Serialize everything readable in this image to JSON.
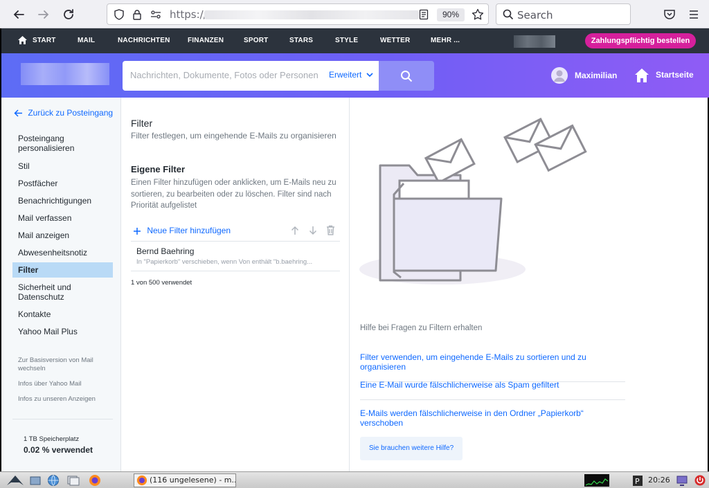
{
  "browser": {
    "url": "https://",
    "zoom": "90%",
    "search_placeholder": "Search"
  },
  "portal_nav": {
    "items": [
      "START",
      "MAIL",
      "NACHRICHTEN",
      "FINANZEN",
      "SPORT",
      "STARS",
      "STYLE",
      "WETTER",
      "MEHR ..."
    ],
    "subscribe": "Zahlungspflichtig bestellen"
  },
  "header": {
    "search_placeholder": "Nachrichten, Dokumente, Fotos oder Personen",
    "advanced": "Erweitert",
    "user_name": "Maximilian",
    "home": "Startseite"
  },
  "sidebar": {
    "back": "Zurück zu Posteingang",
    "items": [
      "Posteingang personalisieren",
      "Stil",
      "Postfächer",
      "Benachrichtigungen",
      "Mail verfassen",
      "Mail anzeigen",
      "Abwesenheitsnotiz",
      "Filter",
      "Sicherheit und Datenschutz",
      "Kontakte",
      "Yahoo Mail Plus"
    ],
    "links": [
      "Zur Basisversion von Mail wechseln",
      "Infos über Yahoo Mail",
      "Infos zu unseren Anzeigen"
    ],
    "storage_label": "1 TB Speicherplatz",
    "storage_value": "0.02 % verwendet"
  },
  "filters": {
    "title": "Filter",
    "subtitle": "Filter festlegen, um eingehende E-Mails zu organisieren",
    "own_title": "Eigene Filter",
    "own_desc": "Einen Filter hinzufügen oder anklicken, um E-Mails neu zu sortieren, zu bearbeiten oder zu löschen. Filter sind nach Priorität aufgelistet",
    "add": "Neue Filter hinzufügen",
    "items": [
      {
        "name": "Bernd Baehring",
        "desc": "In \"Papierkorb\" verschieben, wenn Von enthält \"b.baehring..."
      }
    ],
    "usage": "1 von 500 verwendet"
  },
  "help": {
    "intro": "Hilfe bei Fragen zu Filtern erhalten",
    "links": [
      "Filter verwenden, um eingehende E-Mails zu sortieren und zu organisieren",
      "Eine E-Mail wurde fälschlicherweise als Spam gefiltert",
      "E-Mails werden fälschlicherweise in den Ordner „Papierkorb“ verschoben"
    ],
    "button": "Sie brauchen weitere Hilfe?"
  },
  "taskbar": {
    "app_title": "(116 ungelesene) - m...",
    "clock": "20:26"
  },
  "colors": {
    "accent": "#0f69ff",
    "subscribe": "#d6209c",
    "header_start": "#5d6cf5",
    "header_end": "#8f5cf5",
    "active_item": "#b9daf6"
  }
}
